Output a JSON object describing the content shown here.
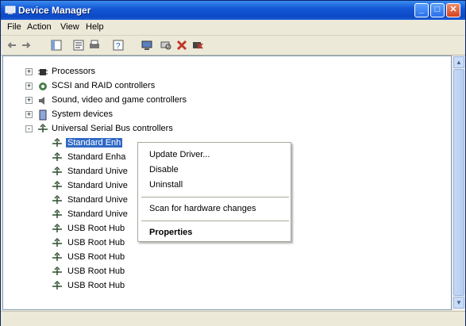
{
  "window": {
    "title": "Device Manager"
  },
  "menubar": {
    "items": [
      "File",
      "Action",
      "View",
      "Help"
    ]
  },
  "tree": {
    "categories": [
      {
        "label": "Processors",
        "expander": "+",
        "icon": "processor-icon"
      },
      {
        "label": "SCSI and RAID controllers",
        "expander": "+",
        "icon": "scsi-controller-icon"
      },
      {
        "label": "Sound, video and game controllers",
        "expander": "+",
        "icon": "sound-icon"
      },
      {
        "label": "System devices",
        "expander": "+",
        "icon": "system-device-icon"
      },
      {
        "label": "Universal Serial Bus controllers",
        "expander": "-",
        "icon": "usb-icon"
      }
    ],
    "usb_children": [
      {
        "label": "Standard Enh",
        "selected": true
      },
      {
        "label": "Standard Enha",
        "selected": false
      },
      {
        "label": "Standard Unive",
        "selected": false
      },
      {
        "label": "Standard Unive",
        "selected": false
      },
      {
        "label": "Standard Unive",
        "selected": false
      },
      {
        "label": "Standard Unive",
        "selected": false
      },
      {
        "label": "USB Root Hub",
        "selected": false
      },
      {
        "label": "USB Root Hub",
        "selected": false
      },
      {
        "label": "USB Root Hub",
        "selected": false
      },
      {
        "label": "USB Root Hub",
        "selected": false
      },
      {
        "label": "USB Root Hub",
        "selected": false
      }
    ]
  },
  "context_menu": {
    "update_driver": "Update Driver...",
    "disable": "Disable",
    "uninstall": "Uninstall",
    "scan": "Scan for hardware changes",
    "properties": "Properties"
  },
  "colors": {
    "title_blue": "#0c49c5",
    "selection": "#316ac5"
  }
}
